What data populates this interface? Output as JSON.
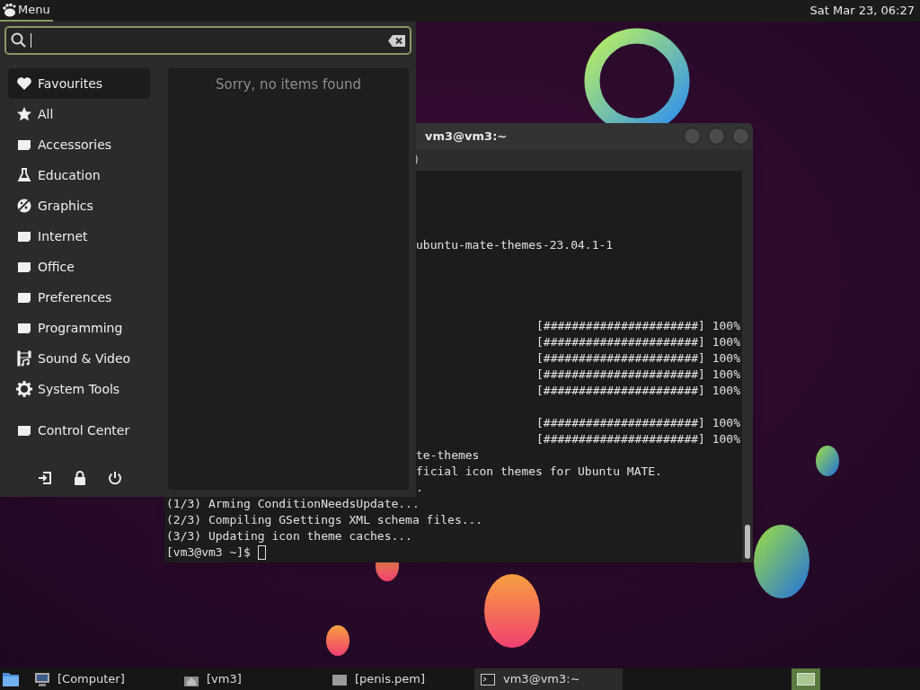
{
  "top_panel": {
    "menu_label": "Menu",
    "clock": "Sat Mar 23, 06:27"
  },
  "menu": {
    "categories": [
      {
        "label": "Favourites",
        "kind": "heart",
        "selected": true
      },
      {
        "label": "All",
        "kind": "star",
        "selected": false
      },
      {
        "label": "Accessories",
        "kind": "folder",
        "selected": false
      },
      {
        "label": "Education",
        "kind": "flask",
        "selected": false
      },
      {
        "label": "Graphics",
        "kind": "palette",
        "selected": false
      },
      {
        "label": "Internet",
        "kind": "folder",
        "selected": false
      },
      {
        "label": "Office",
        "kind": "folder",
        "selected": false
      },
      {
        "label": "Preferences",
        "kind": "folder",
        "selected": false
      },
      {
        "label": "Programming",
        "kind": "folder",
        "selected": false
      },
      {
        "label": "Sound & Video",
        "kind": "media",
        "selected": false
      },
      {
        "label": "System Tools",
        "kind": "gear",
        "selected": false
      }
    ],
    "footer_item": {
      "label": "Control Center",
      "kind": "folder",
      "selected": false
    },
    "empty_message": "Sorry, no items found"
  },
  "terminal": {
    "title": "vm3@vm3:~",
    "menu_fragment": ")",
    "lines": [
      {
        "kind": "blank"
      },
      {
        "kind": "blank"
      },
      {
        "kind": "blank"
      },
      {
        "kind": "blank"
      },
      {
        "kind": "clipped",
        "text": "ubuntu-mate-themes-23.04.1-1"
      },
      {
        "kind": "blank"
      },
      {
        "kind": "blank"
      },
      {
        "kind": "blank"
      },
      {
        "kind": "blank"
      },
      {
        "kind": "progress",
        "text": "[######################] 100%"
      },
      {
        "kind": "progress",
        "text": "[######################] 100%"
      },
      {
        "kind": "progress",
        "text": "[######################] 100%"
      },
      {
        "kind": "progress",
        "text": "[######################] 100%"
      },
      {
        "kind": "progress",
        "text": "[######################] 100%"
      },
      {
        "kind": "blank"
      },
      {
        "kind": "progress",
        "text": "[######################] 100%"
      },
      {
        "kind": "progress",
        "text": "[######################] 100%"
      },
      {
        "kind": "clipped",
        "text": "te-themes"
      },
      {
        "kind": "clipped",
        "text": "ficial icon themes for Ubuntu MATE."
      },
      {
        "kind": "clipped",
        "text": "."
      },
      {
        "kind": "full",
        "text": "(1/3) Arming ConditionNeedsUpdate..."
      },
      {
        "kind": "full",
        "text": "(2/3) Compiling GSettings XML schema files..."
      },
      {
        "kind": "full",
        "text": "(3/3) Updating icon theme caches..."
      },
      {
        "kind": "prompt",
        "text": "[vm3@vm3 ~]$"
      }
    ]
  },
  "taskbar": {
    "items": [
      {
        "kind": "monitor",
        "label": "[Computer]",
        "selected": false
      },
      {
        "kind": "home",
        "label": "[vm3]",
        "selected": false
      },
      {
        "kind": "file",
        "label": "[penis.pem]",
        "selected": false
      },
      {
        "kind": "terminal",
        "label": "vm3@vm3:~",
        "selected": true
      }
    ]
  }
}
